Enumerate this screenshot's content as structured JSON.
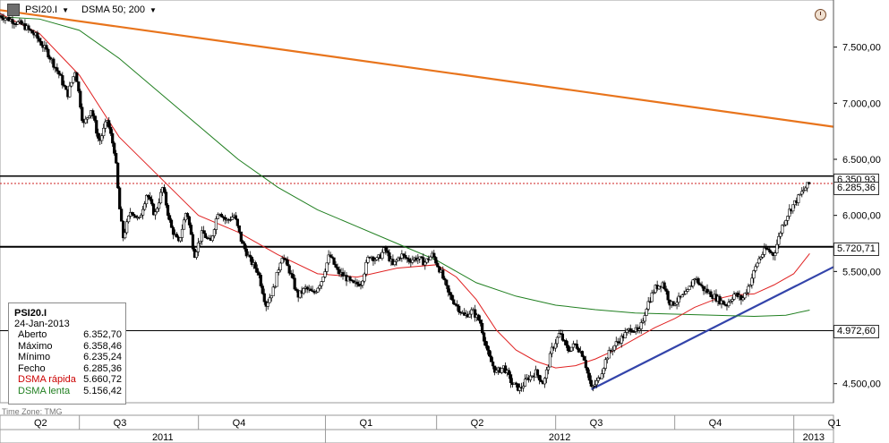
{
  "toolbar": {
    "symbol": "PSI20.I",
    "indicator": "DSMA 50; 200"
  },
  "legend": {
    "title": "PSI20.I",
    "date": "24-Jan-2013",
    "rows": [
      {
        "label": "Aberto",
        "value": "6.352,70",
        "color": "#000000"
      },
      {
        "label": "Máximo",
        "value": "6.358,46",
        "color": "#000000"
      },
      {
        "label": "Mínimo",
        "value": "6.235,24",
        "color": "#000000"
      },
      {
        "label": "Fecho",
        "value": "6.285,36",
        "color": "#000000"
      },
      {
        "label": "DSMA rápida",
        "value": "5.660,72",
        "color": "#cc0000"
      },
      {
        "label": "DSMA lenta",
        "value": "5.156,42",
        "color": "#207f20"
      }
    ]
  },
  "time_zone": "Time Zone: TMG",
  "price_tags": {
    "upper": "6.350,93",
    "close": "6.285,36",
    "mid": "5.720,71",
    "low": "4.972,60"
  },
  "chart_data": {
    "type": "candlestick",
    "yaxis": {
      "ticks": [
        7500,
        7000,
        6500,
        6000,
        5500,
        5000,
        4500
      ],
      "tick_labels": [
        "7.500,00",
        "7.000,00",
        "6.500,00",
        "6.000,00",
        "5.500,00",
        "",
        "4.500,00"
      ],
      "range": [
        4330,
        7920
      ]
    },
    "xaxis": {
      "quarters": [
        {
          "label": "Q2",
          "start": 0.0,
          "end": 2.0
        },
        {
          "label": "Q3",
          "start": 2.0,
          "end": 5.0
        },
        {
          "label": "Q4",
          "start": 5.0,
          "end": 8.2
        },
        {
          "label": "Q1",
          "start": 8.2,
          "end": 11.0
        },
        {
          "label": "Q2",
          "start": 11.0,
          "end": 14.0
        },
        {
          "label": "Q3",
          "start": 14.0,
          "end": 17.0
        },
        {
          "label": "Q4",
          "start": 17.0,
          "end": 20.0
        },
        {
          "label": "Q1",
          "start": 20.0,
          "end": 21.0
        }
      ],
      "years": [
        {
          "label": "2011",
          "start": 0.0,
          "end": 8.2
        },
        {
          "label": "2012",
          "start": 8.2,
          "end": 20.0
        },
        {
          "label": "2013",
          "start": 20.0,
          "end": 21.0
        }
      ],
      "month_range": [
        0,
        21
      ]
    },
    "close_series": [
      [
        0.0,
        7780
      ],
      [
        0.3,
        7740
      ],
      [
        0.6,
        7690
      ],
      [
        0.9,
        7600
      ],
      [
        1.2,
        7450
      ],
      [
        1.5,
        7250
      ],
      [
        1.7,
        7070
      ],
      [
        1.9,
        7300
      ],
      [
        2.1,
        6800
      ],
      [
        2.3,
        6950
      ],
      [
        2.5,
        6650
      ],
      [
        2.7,
        6850
      ],
      [
        2.9,
        6550
      ],
      [
        3.0,
        6100
      ],
      [
        3.1,
        5800
      ],
      [
        3.3,
        6050
      ],
      [
        3.5,
        5950
      ],
      [
        3.7,
        6200
      ],
      [
        3.9,
        6000
      ],
      [
        4.1,
        6250
      ],
      [
        4.3,
        5900
      ],
      [
        4.5,
        5750
      ],
      [
        4.7,
        6050
      ],
      [
        4.9,
        5650
      ],
      [
        5.1,
        5850
      ],
      [
        5.3,
        5750
      ],
      [
        5.5,
        6050
      ],
      [
        5.7,
        5950
      ],
      [
        5.9,
        6000
      ],
      [
        6.1,
        5750
      ],
      [
        6.3,
        5600
      ],
      [
        6.5,
        5500
      ],
      [
        6.7,
        5200
      ],
      [
        6.9,
        5350
      ],
      [
        7.1,
        5650
      ],
      [
        7.3,
        5500
      ],
      [
        7.5,
        5280
      ],
      [
        7.7,
        5350
      ],
      [
        7.9,
        5300
      ],
      [
        8.1,
        5420
      ],
      [
        8.3,
        5650
      ],
      [
        8.5,
        5500
      ],
      [
        8.7,
        5450
      ],
      [
        8.9,
        5380
      ],
      [
        9.1,
        5400
      ],
      [
        9.3,
        5650
      ],
      [
        9.5,
        5600
      ],
      [
        9.7,
        5700
      ],
      [
        9.9,
        5550
      ],
      [
        10.1,
        5650
      ],
      [
        10.3,
        5600
      ],
      [
        10.5,
        5620
      ],
      [
        10.7,
        5580
      ],
      [
        10.9,
        5650
      ],
      [
        11.1,
        5500
      ],
      [
        11.3,
        5300
      ],
      [
        11.5,
        5200
      ],
      [
        11.7,
        5100
      ],
      [
        11.9,
        5150
      ],
      [
        12.1,
        5050
      ],
      [
        12.3,
        4750
      ],
      [
        12.5,
        4600
      ],
      [
        12.7,
        4650
      ],
      [
        12.9,
        4500
      ],
      [
        13.1,
        4450
      ],
      [
        13.3,
        4550
      ],
      [
        13.5,
        4600
      ],
      [
        13.7,
        4500
      ],
      [
        13.9,
        4800
      ],
      [
        14.1,
        4950
      ],
      [
        14.3,
        4800
      ],
      [
        14.5,
        4850
      ],
      [
        14.7,
        4750
      ],
      [
        14.9,
        4450
      ],
      [
        15.1,
        4550
      ],
      [
        15.3,
        4750
      ],
      [
        15.5,
        4850
      ],
      [
        15.7,
        4920
      ],
      [
        15.9,
        5000
      ],
      [
        16.1,
        4950
      ],
      [
        16.3,
        5200
      ],
      [
        16.5,
        5350
      ],
      [
        16.7,
        5400
      ],
      [
        16.9,
        5200
      ],
      [
        17.1,
        5250
      ],
      [
        17.3,
        5300
      ],
      [
        17.5,
        5450
      ],
      [
        17.7,
        5350
      ],
      [
        17.9,
        5300
      ],
      [
        18.1,
        5250
      ],
      [
        18.3,
        5200
      ],
      [
        18.5,
        5300
      ],
      [
        18.7,
        5250
      ],
      [
        18.9,
        5400
      ],
      [
        19.1,
        5600
      ],
      [
        19.3,
        5700
      ],
      [
        19.5,
        5650
      ],
      [
        19.7,
        5900
      ],
      [
        19.9,
        6050
      ],
      [
        20.1,
        6150
      ],
      [
        20.3,
        6250
      ],
      [
        20.4,
        6285
      ]
    ],
    "dsma_fast": [
      [
        0.0,
        7800
      ],
      [
        1.0,
        7620
      ],
      [
        2.0,
        7250
      ],
      [
        3.0,
        6700
      ],
      [
        4.0,
        6350
      ],
      [
        5.0,
        6000
      ],
      [
        6.0,
        5850
      ],
      [
        7.0,
        5650
      ],
      [
        8.0,
        5480
      ],
      [
        9.0,
        5450
      ],
      [
        10.0,
        5530
      ],
      [
        11.0,
        5560
      ],
      [
        11.5,
        5450
      ],
      [
        12.0,
        5250
      ],
      [
        12.5,
        4980
      ],
      [
        13.0,
        4800
      ],
      [
        13.5,
        4700
      ],
      [
        14.0,
        4640
      ],
      [
        14.5,
        4660
      ],
      [
        15.0,
        4720
      ],
      [
        15.5,
        4800
      ],
      [
        16.0,
        4900
      ],
      [
        16.5,
        5000
      ],
      [
        17.0,
        5080
      ],
      [
        17.5,
        5180
      ],
      [
        18.0,
        5250
      ],
      [
        18.5,
        5290
      ],
      [
        19.0,
        5300
      ],
      [
        19.5,
        5380
      ],
      [
        20.0,
        5480
      ],
      [
        20.4,
        5660
      ]
    ],
    "dsma_slow": [
      [
        0.0,
        7770
      ],
      [
        1.0,
        7750
      ],
      [
        2.0,
        7650
      ],
      [
        3.0,
        7400
      ],
      [
        4.0,
        7100
      ],
      [
        5.0,
        6800
      ],
      [
        6.0,
        6500
      ],
      [
        7.0,
        6250
      ],
      [
        8.0,
        6050
      ],
      [
        9.0,
        5900
      ],
      [
        10.0,
        5750
      ],
      [
        11.0,
        5600
      ],
      [
        12.0,
        5400
      ],
      [
        13.0,
        5280
      ],
      [
        14.0,
        5200
      ],
      [
        15.0,
        5160
      ],
      [
        16.0,
        5130
      ],
      [
        17.0,
        5120
      ],
      [
        18.0,
        5110
      ],
      [
        19.0,
        5100
      ],
      [
        19.8,
        5110
      ],
      [
        20.4,
        5156
      ]
    ],
    "trendlines": [
      {
        "name": "orange-downtrend",
        "color": "#e8741c",
        "from": [
          0.0,
          7830
        ],
        "to": [
          21.0,
          6790
        ]
      },
      {
        "name": "blue-uptrend",
        "color": "#3344aa",
        "from": [
          14.9,
          4450
        ],
        "to": [
          21.0,
          5540
        ]
      }
    ],
    "hlines": [
      6350,
      6285,
      5720,
      4972
    ]
  }
}
